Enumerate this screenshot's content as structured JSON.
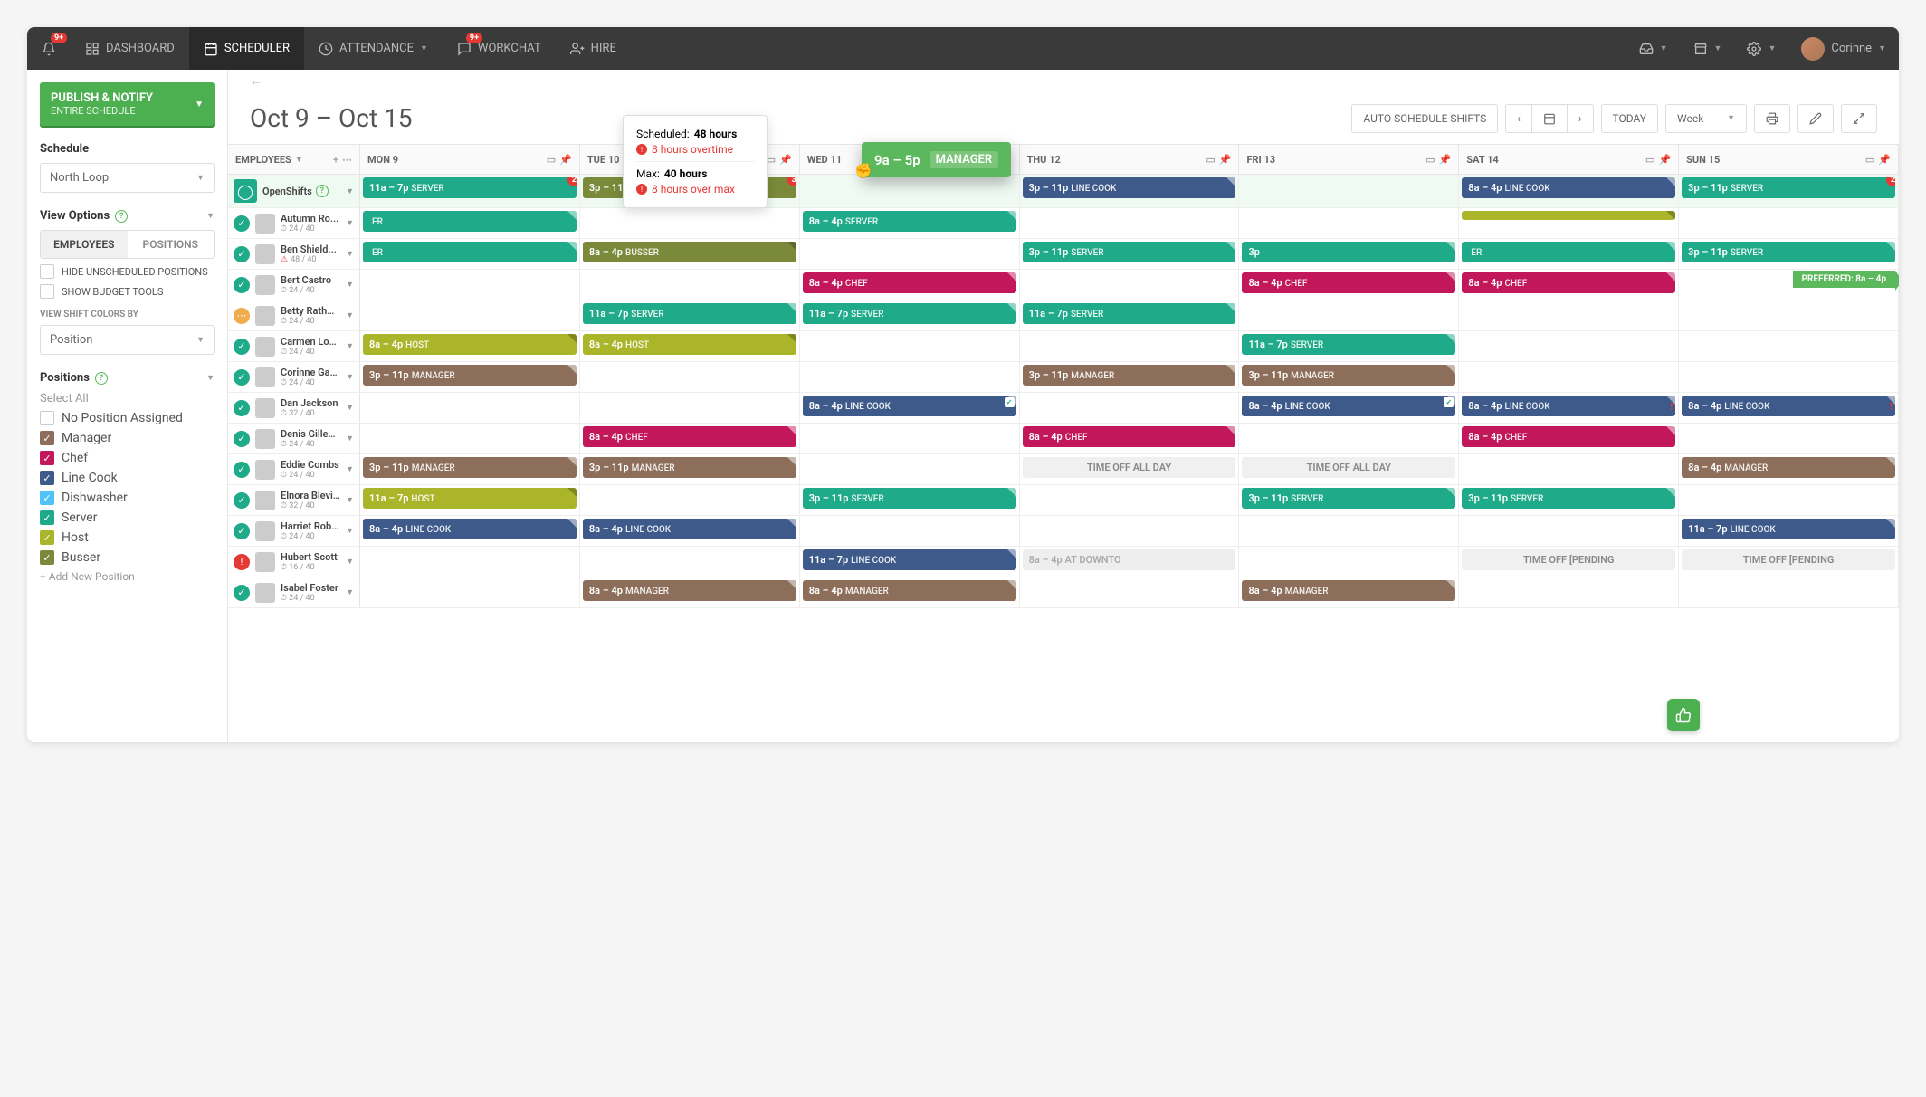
{
  "topbar": {
    "bell_badge": "9+",
    "items": [
      {
        "label": "DASHBOARD"
      },
      {
        "label": "SCHEDULER"
      },
      {
        "label": "ATTENDANCE"
      },
      {
        "label": "WORKCHAT",
        "badge": "9+"
      },
      {
        "label": "HIRE"
      }
    ],
    "user": "Corinne"
  },
  "sidebar": {
    "publish": {
      "t1": "PUBLISH & NOTIFY",
      "t2": "ENTIRE SCHEDULE"
    },
    "schedule_h": "Schedule",
    "schedule_sel": "North Loop",
    "view_opts_h": "View Options",
    "seg": {
      "a": "EMPLOYEES",
      "b": "POSITIONS"
    },
    "hide_unsched": "HIDE UNSCHEDULED POSITIONS",
    "show_budget": "SHOW BUDGET TOOLS",
    "colors_lbl": "VIEW SHIFT COLORS BY",
    "colors_sel": "Position",
    "positions_h": "Positions",
    "select_all": "Select All",
    "positions": [
      {
        "label": "No Position Assigned",
        "on": false,
        "color": "#fff"
      },
      {
        "label": "Manager",
        "on": true,
        "color": "#8d6e5a"
      },
      {
        "label": "Chef",
        "on": true,
        "color": "#c2185b"
      },
      {
        "label": "Line Cook",
        "on": true,
        "color": "#3d5a8a"
      },
      {
        "label": "Dishwasher",
        "on": true,
        "color": "#4fc3f7"
      },
      {
        "label": "Server",
        "on": true,
        "color": "#1fab89"
      },
      {
        "label": "Host",
        "on": true,
        "color": "#aab52a"
      },
      {
        "label": "Busser",
        "on": true,
        "color": "#7a8a3a"
      }
    ],
    "add_pos": "+ Add New Position"
  },
  "header": {
    "range": "Oct 9 – Oct 15",
    "auto": "AUTO SCHEDULE SHIFTS",
    "today": "TODAY",
    "view": "Week"
  },
  "days": [
    "MON 9",
    "TUE 10",
    "WED 11",
    "THU 12",
    "FRI 13",
    "SAT 14",
    "SUN 15"
  ],
  "emp_hdr": "EMPLOYEES",
  "open_label": "OpenShifts",
  "open_row": [
    {
      "t": "11a – 7p",
      "p": "SERVER",
      "c": "#1fab89",
      "badge": "2"
    },
    {
      "t": "3p – 11p",
      "p": "BUSSER",
      "c": "#7a8a3a",
      "badge": "3"
    },
    null,
    {
      "t": "3p – 11p",
      "p": "LINE COOK",
      "c": "#3d5a8a"
    },
    null,
    {
      "t": "8a – 4p",
      "p": "LINE COOK",
      "c": "#3d5a8a"
    },
    {
      "t": "3p – 11p",
      "p": "SERVER",
      "c": "#1fab89",
      "badge": "2"
    }
  ],
  "employees": [
    {
      "name": "Autumn Ro...",
      "hrs": "24 / 40",
      "status": "ok",
      "shifts": [
        {
          "t": "",
          "p": "ER",
          "c": "#1fab89"
        },
        null,
        {
          "t": "8a – 4p",
          "p": "SERVER",
          "c": "#1fab89"
        },
        null,
        null,
        {
          "t": "",
          "p": "",
          "c": "#aab52a",
          "plain": true
        },
        null
      ]
    },
    {
      "name": "Ben Shield...",
      "hrs": "48 / 40",
      "status": "ok",
      "warn": true,
      "shifts": [
        {
          "t": "",
          "p": "ER",
          "c": "#1fab89"
        },
        {
          "t": "8a – 4p",
          "p": "BUSSER",
          "c": "#7a8a3a"
        },
        null,
        {
          "t": "3p – 11p",
          "p": "SERVER",
          "c": "#1fab89"
        },
        {
          "t": "3p",
          "p": "",
          "c": "#1fab89",
          "half": true
        },
        {
          "t": "",
          "p": "ER",
          "c": "#1fab89",
          "half2": true
        },
        {
          "t": "3p – 11p",
          "p": "SERVER",
          "c": "#1fab89"
        }
      ]
    },
    {
      "name": "Bert Castro",
      "hrs": "24 / 40",
      "status": "ok",
      "shifts": [
        null,
        null,
        {
          "t": "8a – 4p",
          "p": "CHEF",
          "c": "#c2185b"
        },
        null,
        {
          "t": "8a – 4p",
          "p": "CHEF",
          "c": "#c2185b"
        },
        {
          "t": "8a – 4p",
          "p": "CHEF",
          "c": "#c2185b"
        },
        null
      ]
    },
    {
      "name": "Betty Rathmen",
      "hrs": "24 / 40",
      "status": "pending",
      "shifts": [
        null,
        {
          "t": "11a – 7p",
          "p": "SERVER",
          "c": "#1fab89"
        },
        {
          "t": "11a – 7p",
          "p": "SERVER",
          "c": "#1fab89"
        },
        {
          "t": "11a – 7p",
          "p": "SERVER",
          "c": "#1fab89"
        },
        null,
        null,
        null
      ]
    },
    {
      "name": "Carmen Lowe",
      "hrs": "24 / 40",
      "status": "ok",
      "shifts": [
        {
          "t": "8a – 4p",
          "p": "HOST",
          "c": "#aab52a"
        },
        {
          "t": "8a – 4p",
          "p": "HOST",
          "c": "#aab52a"
        },
        null,
        null,
        {
          "t": "11a – 7p",
          "p": "SERVER",
          "c": "#1fab89"
        },
        null,
        null
      ]
    },
    {
      "name": "Corinne Garris...",
      "hrs": "24 / 40",
      "status": "ok",
      "shifts": [
        {
          "t": "3p – 11p",
          "p": "MANAGER",
          "c": "#8d6e5a"
        },
        null,
        null,
        {
          "t": "3p – 11p",
          "p": "MANAGER",
          "c": "#8d6e5a"
        },
        {
          "t": "3p – 11p",
          "p": "MANAGER",
          "c": "#8d6e5a"
        },
        null,
        null
      ]
    },
    {
      "name": "Dan Jackson",
      "hrs": "32 / 40",
      "status": "ok",
      "shifts": [
        null,
        null,
        {
          "t": "8a – 4p",
          "p": "LINE COOK",
          "c": "#3d5a8a",
          "check": true
        },
        null,
        {
          "t": "8a – 4p",
          "p": "LINE COOK",
          "c": "#3d5a8a",
          "check": true
        },
        {
          "t": "8a – 4p",
          "p": "LINE COOK",
          "c": "#3d5a8a",
          "warn": true
        },
        {
          "t": "8a – 4p",
          "p": "LINE COOK",
          "c": "#3d5a8a",
          "warn": true
        }
      ]
    },
    {
      "name": "Denis Gillespie",
      "hrs": "24 / 40",
      "status": "ok",
      "shifts": [
        null,
        {
          "t": "8a – 4p",
          "p": "CHEF",
          "c": "#c2185b"
        },
        null,
        {
          "t": "8a – 4p",
          "p": "CHEF",
          "c": "#c2185b",
          "striped": true
        },
        null,
        {
          "t": "8a – 4p",
          "p": "CHEF",
          "c": "#c2185b",
          "striped": true
        },
        null
      ]
    },
    {
      "name": "Eddie Combs",
      "hrs": "24 / 40",
      "status": "ok",
      "shifts": [
        {
          "t": "3p – 11p",
          "p": "MANAGER",
          "c": "#8d6e5a"
        },
        {
          "t": "3p – 11p",
          "p": "MANAGER",
          "c": "#8d6e5a"
        },
        null,
        {
          "t": "TIME OFF ALL DAY",
          "timeoff": true
        },
        {
          "t": "TIME OFF ALL DAY",
          "timeoff": true
        },
        null,
        {
          "t": "8a – 4p",
          "p": "MANAGER",
          "c": "#8d6e5a"
        }
      ]
    },
    {
      "name": "Elnora Blevins",
      "hrs": "32 / 40",
      "status": "ok",
      "shifts": [
        {
          "t": "11a – 7p",
          "p": "HOST",
          "c": "#aab52a"
        },
        null,
        {
          "t": "3p – 11p",
          "p": "SERVER",
          "c": "#1fab89"
        },
        null,
        {
          "t": "3p – 11p",
          "p": "SERVER",
          "c": "#1fab89"
        },
        {
          "t": "3p – 11p",
          "p": "SERVER",
          "c": "#1fab89"
        },
        null
      ]
    },
    {
      "name": "Harriet Roberts",
      "hrs": "24 / 40",
      "status": "ok",
      "shifts": [
        {
          "t": "8a – 4p",
          "p": "LINE COOK",
          "c": "#3d5a8a",
          "striped": true
        },
        {
          "t": "8a – 4p",
          "p": "LINE COOK",
          "c": "#3d5a8a",
          "striped": true
        },
        null,
        null,
        null,
        null,
        {
          "t": "11a – 7p",
          "p": "LINE COOK",
          "c": "#3d5a8a"
        }
      ]
    },
    {
      "name": "Hubert Scott",
      "hrs": "16 / 40",
      "status": "alert",
      "shifts": [
        null,
        null,
        {
          "t": "11a – 7p",
          "p": "LINE COOK",
          "c": "#3d5a8a"
        },
        {
          "t": "8a – 4p  AT DOWNTO",
          "faded": true
        },
        null,
        {
          "t": "TIME OFF [PENDING",
          "timeoff": true
        },
        {
          "t": "TIME OFF [PENDING",
          "timeoff": true
        }
      ]
    },
    {
      "name": "Isabel Foster",
      "hrs": "24 / 40",
      "status": "ok",
      "shifts": [
        null,
        {
          "t": "8a – 4p",
          "p": "MANAGER",
          "c": "#8d6e5a"
        },
        {
          "t": "8a – 4p",
          "p": "MANAGER",
          "c": "#8d6e5a"
        },
        null,
        {
          "t": "8a – 4p",
          "p": "MANAGER",
          "c": "#8d6e5a"
        },
        null,
        null
      ]
    }
  ],
  "tooltip": {
    "sched_l": "Scheduled:",
    "sched_v": "48 hours",
    "ot": "8 hours overtime",
    "max_l": "Max:",
    "max_v": "40 hours",
    "over": "8 hours over max"
  },
  "drag": {
    "time": "9a – 5p",
    "pos": "MANAGER"
  },
  "preferred": "PREFERRED: 8a – 4p",
  "colors": {
    "ok": "#1fab89",
    "pending": "#f0ad4e",
    "alert": "#e53935"
  }
}
